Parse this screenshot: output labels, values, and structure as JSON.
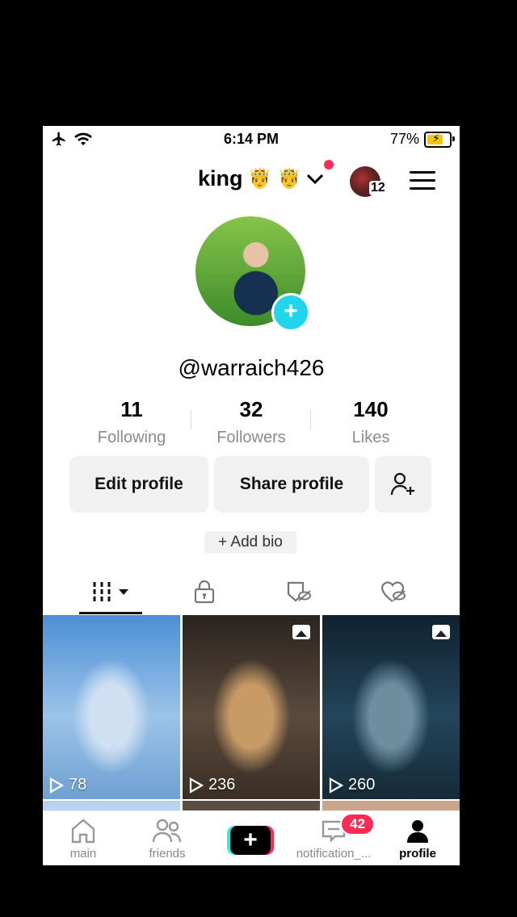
{
  "status": {
    "time": "6:14 PM",
    "battery": "77%"
  },
  "header": {
    "username": "king",
    "emoji": "🤴 🤴",
    "notif_count": "12"
  },
  "profile": {
    "handle": "@warraich426",
    "add_symbol": "+"
  },
  "stats": [
    {
      "value": "11",
      "label": "Following"
    },
    {
      "value": "32",
      "label": "Followers"
    },
    {
      "value": "140",
      "label": "Likes"
    }
  ],
  "buttons": {
    "edit": "Edit profile",
    "share": "Share profile"
  },
  "bio": {
    "add_label": "+ Add bio"
  },
  "videos": [
    {
      "views": "78",
      "colors": [
        "#4c8fd6",
        "#9cc3e8",
        "#cfe0f2",
        "#6fa0d2"
      ]
    },
    {
      "views": "236",
      "colors": [
        "#2a2420",
        "#5b4a3c",
        "#c89b66",
        "#3a2e25"
      ]
    },
    {
      "views": "260",
      "colors": [
        "#0f2230",
        "#24455a",
        "#6e8ea0",
        "#142a38"
      ]
    }
  ],
  "nav": {
    "home": "main",
    "friends": "friends",
    "notifications": "notification_...",
    "notif_badge": "42",
    "profile": "profile",
    "create": "+"
  },
  "colors": {
    "accent": "#fe2c55",
    "cyan": "#25f4ee",
    "plus_blue": "#20d5ec"
  }
}
